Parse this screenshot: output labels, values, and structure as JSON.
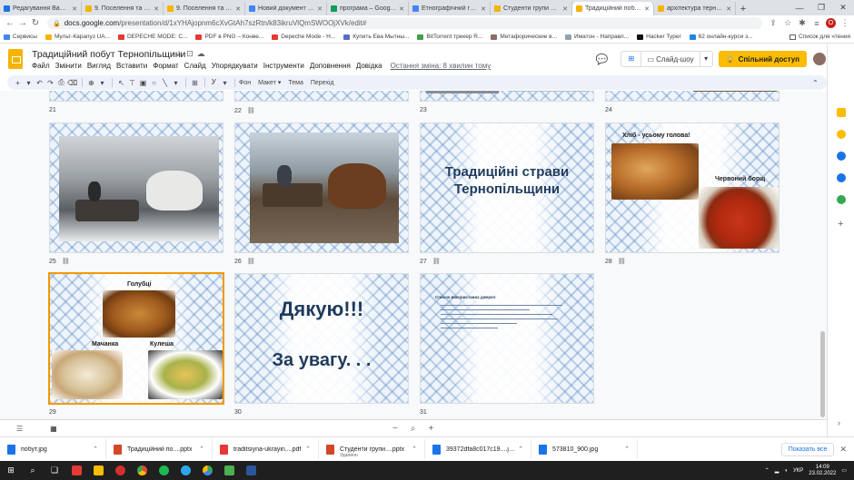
{
  "browser": {
    "tabs": [
      {
        "label": "Редагування Вашого",
        "color": "#1a73e8"
      },
      {
        "label": "9. Поселення та житло",
        "color": "#f4b400"
      },
      {
        "label": "9. Поселення та житло",
        "color": "#f4b400"
      },
      {
        "label": "Новий документ - Goo",
        "color": "#4285f4"
      },
      {
        "label": "програма – Google Д",
        "color": "#0f9d58"
      },
      {
        "label": "Етнографічний гурток",
        "color": "#4285f4"
      },
      {
        "label": "Студенти групи ПП-",
        "color": "#f4b400"
      },
      {
        "label": "Традиційний побут Т",
        "color": "#f4b400",
        "active": true
      },
      {
        "label": "архітектура тернопіл",
        "color": "#f4b400"
      }
    ],
    "new_tab": "+",
    "url_host": "docs.google.com",
    "url_path": "/presentation/d/1xYHAjopnm6cXvGtAh7szRtn/k83ikruVlQmSWOOjXVk/edit#",
    "bookmarks": [
      {
        "label": "Сервисы",
        "color": "#4285f4"
      },
      {
        "label": "Мульт-Карапуз UA...",
        "color": "#f4b400"
      },
      {
        "label": "DEPECHE MODE: C...",
        "color": "#e53935"
      },
      {
        "label": "PDF в PNG – Конве...",
        "color": "#e53935"
      },
      {
        "label": "Depeche Mode - H...",
        "color": "#e53935"
      },
      {
        "label": "Купить Ева Мытны...",
        "color": "#5c6bc0"
      },
      {
        "label": "BitTorrent трекер R...",
        "color": "#43a047"
      },
      {
        "label": "Метафорические в...",
        "color": "#8d6e63"
      },
      {
        "label": "Иматон - Направл...",
        "color": "#90a4ae"
      },
      {
        "label": "Hacker Typer",
        "color": "#111111"
      },
      {
        "label": "62 онлайн-курси з...",
        "color": "#1e88e5"
      }
    ],
    "bookmarks_right": "Список для чтения"
  },
  "slides_app": {
    "title": "Традиційний побут Тернопільщини",
    "menu": [
      "Файл",
      "Змінити",
      "Вигляд",
      "Вставити",
      "Формат",
      "Слайд",
      "Упорядкувати",
      "Інструменти",
      "Доповнення",
      "Довідка"
    ],
    "last_edit": "Остання зміна: 8 хвилин тому",
    "slideshow_label": "Слайд-шоу",
    "share_label": "Спільний доступ",
    "toolbar": {
      "background": "Фон",
      "layout": "Макет",
      "theme": "Тема",
      "transition": "Перехід"
    }
  },
  "slides": {
    "row0_numbers": [
      "21",
      "22",
      "23",
      "24"
    ],
    "s25": {
      "number": "25"
    },
    "s26": {
      "number": "26"
    },
    "s27": {
      "number": "27",
      "title_line1": "Традиційні страви",
      "title_line2": "Тернопільщини"
    },
    "s28": {
      "number": "28",
      "caption_bread": "Хліб - усьому голова!",
      "caption_borsch": "Червоний борщ"
    },
    "s29": {
      "number": "29",
      "caption_golubci": "Голубці",
      "caption_machanka": "Мачанка",
      "caption_kulesha": "Кулеша"
    },
    "s30": {
      "number": "30",
      "line1": "Дякую!!!",
      "line2": "За увагу. . ."
    },
    "s31": {
      "number": "31",
      "heading": "Список використаних джерел"
    }
  },
  "downloads": [
    {
      "name": "побут.jpg",
      "color": "#1a73e8"
    },
    {
      "name": "Традиційний по....pptx",
      "color": "#d24726"
    },
    {
      "name": "traditsiyna-ukrayin....pdf",
      "color": "#e53935"
    },
    {
      "name": "Студенти групи....pptx",
      "color": "#d24726",
      "sub": "Удалено"
    },
    {
      "name": "39372dfa8c017c19....jpg",
      "color": "#1a73e8"
    },
    {
      "name": "573810_900.jpg",
      "color": "#1a73e8"
    }
  ],
  "downloads_show_all": "Показать все",
  "taskbar": {
    "lang": "УКР",
    "time": "14:09",
    "date": "23.02.2022"
  }
}
